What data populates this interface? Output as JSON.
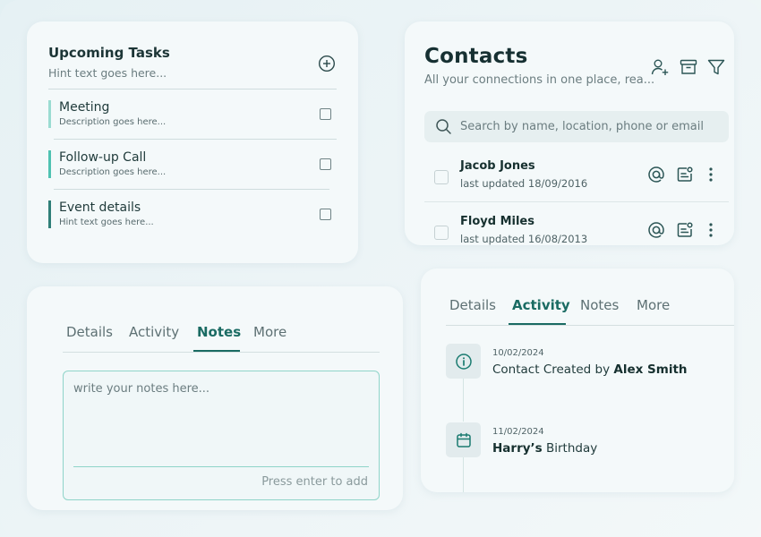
{
  "tasks": {
    "title": "Upcoming Tasks",
    "hint": "Hint text goes here...",
    "items": [
      {
        "title": "Meeting",
        "description": "Description goes here...",
        "accent": "#9bdcd2"
      },
      {
        "title": "Follow-up Call",
        "description": "Description goes here...",
        "accent": "#4fc2b2"
      },
      {
        "title": "Event details",
        "description": "Hint text goes here...",
        "accent": "#2f7f78"
      }
    ]
  },
  "contacts": {
    "title": "Contacts",
    "subtitle": "All your connections in one place, rea...",
    "search_placeholder": "Search by name, location, phone or email",
    "list": [
      {
        "name": "Jacob Jones",
        "updated": "last updated 18/09/2016"
      },
      {
        "name": "Floyd Miles",
        "updated": "last updated 16/08/2013"
      }
    ]
  },
  "notes": {
    "tabs": [
      "Details",
      "Activity",
      "Notes",
      "More"
    ],
    "active_tab": "Notes",
    "placeholder": "write your notes here...",
    "enter_hint": "Press enter to add"
  },
  "activity": {
    "tabs": [
      "Details",
      "Activity",
      "Notes",
      "More"
    ],
    "active_tab": "Activity",
    "events": [
      {
        "date": "10/02/2024",
        "prefix": "Contact Created by ",
        "bold": "Alex Smith",
        "suffix": "",
        "icon": "info-icon"
      },
      {
        "date": "11/02/2024",
        "prefix": "",
        "bold": "Harry’s",
        "suffix": " Birthday",
        "icon": "calendar-icon"
      }
    ]
  },
  "colors": {
    "accent": "#1a6b63",
    "icon": "#2b5555"
  }
}
